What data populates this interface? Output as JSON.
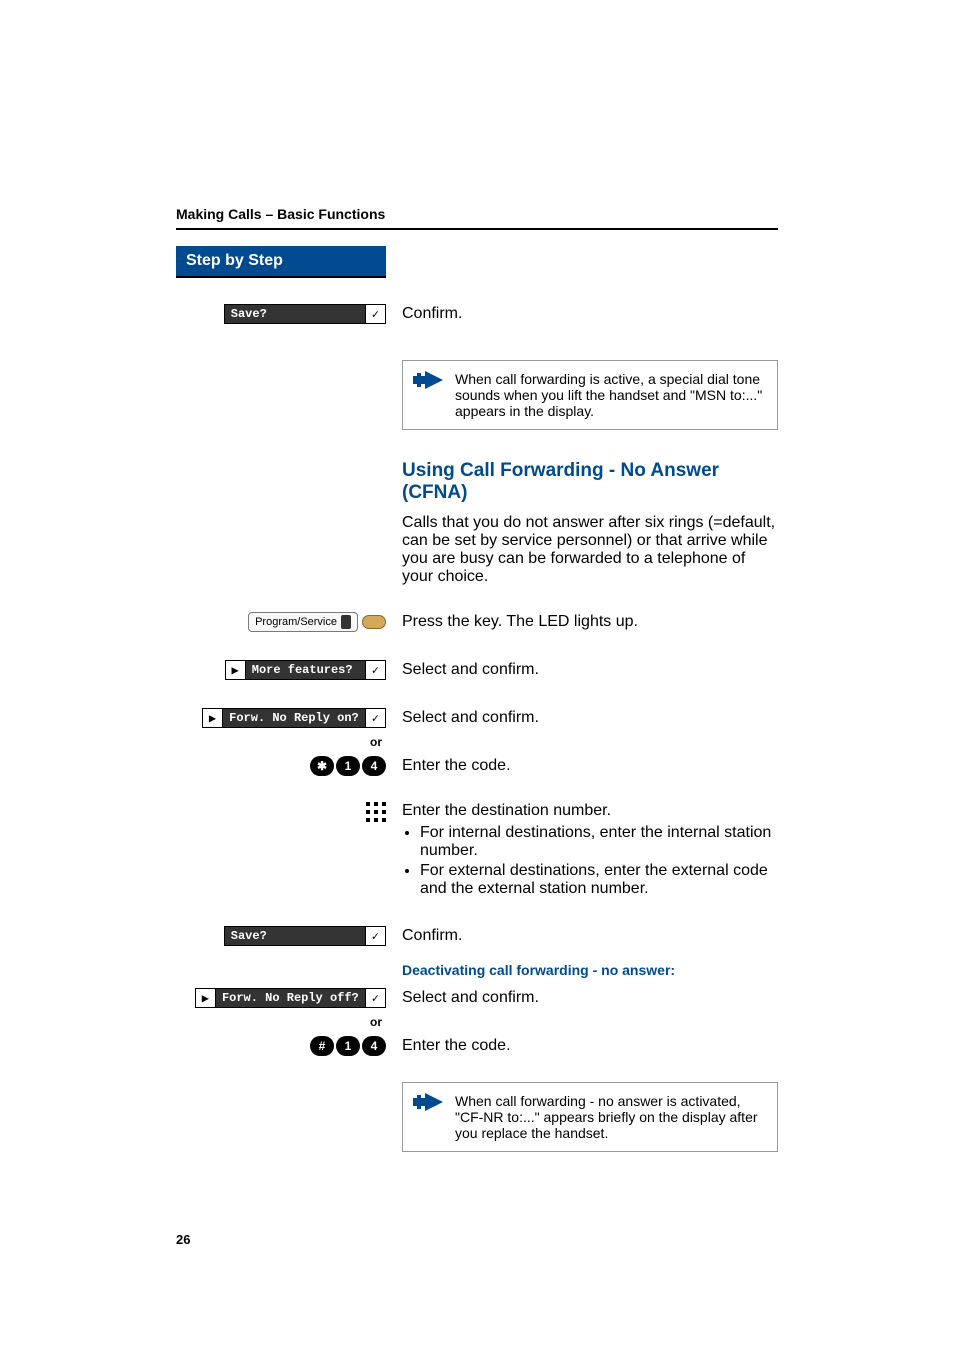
{
  "running_header": "Making Calls – Basic Functions",
  "step_by_step": "Step by Step",
  "or_label": "or",
  "pills": {
    "save": {
      "label": "Save?",
      "tick": "✓"
    },
    "more_features": {
      "arrow": "▶",
      "label": "More features?",
      "tick": "✓"
    },
    "forw_on": {
      "arrow": "▶",
      "label": "Forw. No Reply on?",
      "tick": "✓"
    },
    "forw_off": {
      "arrow": "▶",
      "label": "Forw. No Reply off?",
      "tick": "✓"
    }
  },
  "softkey": {
    "label": "Program/Service"
  },
  "keys": {
    "code_on": [
      "✱",
      "1",
      "4"
    ],
    "code_off": [
      "#",
      "1",
      "4"
    ]
  },
  "right": {
    "confirm": "Confirm.",
    "note1": "When call forwarding is active, a special dial tone sounds when you lift the handset and \"MSN to:...\" appears in the display.",
    "section_title": "Using Call Forwarding - No Answer (CFNA)",
    "intro": "Calls that you do not answer after six rings (=default, can be set by service personnel) or that arrive while you are busy can be forwarded to a telephone of your choice.",
    "press_key": "Press the key. The LED lights up.",
    "select_confirm": "Select and confirm.",
    "enter_code": "Enter the code.",
    "enter_dest": "Enter the destination number.",
    "bullet_internal": "For internal destinations, enter the internal station number.",
    "bullet_external": "For external destinations, enter the external code and the external station number.",
    "deactivate_title": "Deactivating call forwarding - no answer:",
    "note2": "When call forwarding - no answer is activated, \"CF-NR to:...\" appears briefly on the display after you replace the handset."
  },
  "page_number": "26"
}
